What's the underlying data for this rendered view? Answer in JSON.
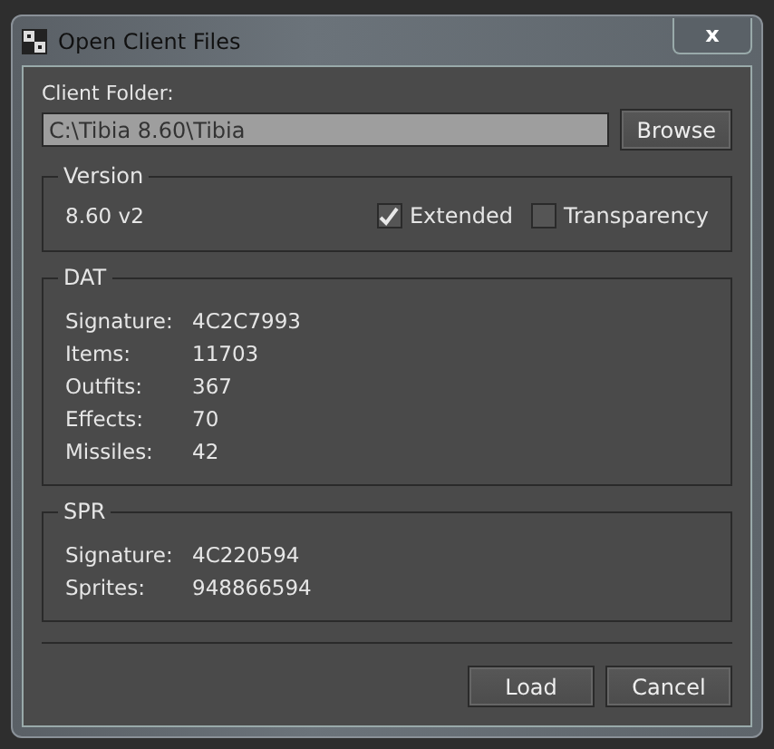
{
  "window": {
    "title": "Open Client Files",
    "close": "x"
  },
  "client_folder": {
    "label": "Client Folder:",
    "value": "C:\\Tibia 8.60\\Tibia",
    "button": "Browse"
  },
  "version": {
    "title": "Version",
    "value": "8.60 v2",
    "options": [
      {
        "label": "Extended",
        "checked": true
      },
      {
        "label": "Transparency",
        "checked": false
      }
    ]
  },
  "dat": {
    "title": "DAT",
    "rows": [
      {
        "label": "Signature:",
        "value": "4C2C7993"
      },
      {
        "label": "Items:",
        "value": "11703"
      },
      {
        "label": "Outfits:",
        "value": "367"
      },
      {
        "label": "Effects:",
        "value": "70"
      },
      {
        "label": "Missiles:",
        "value": "42"
      }
    ]
  },
  "spr": {
    "title": "SPR",
    "rows": [
      {
        "label": "Signature:",
        "value": "4C220594"
      },
      {
        "label": "Sprites:",
        "value": "948866594"
      }
    ]
  },
  "buttons": [
    "Load",
    "Cancel"
  ]
}
